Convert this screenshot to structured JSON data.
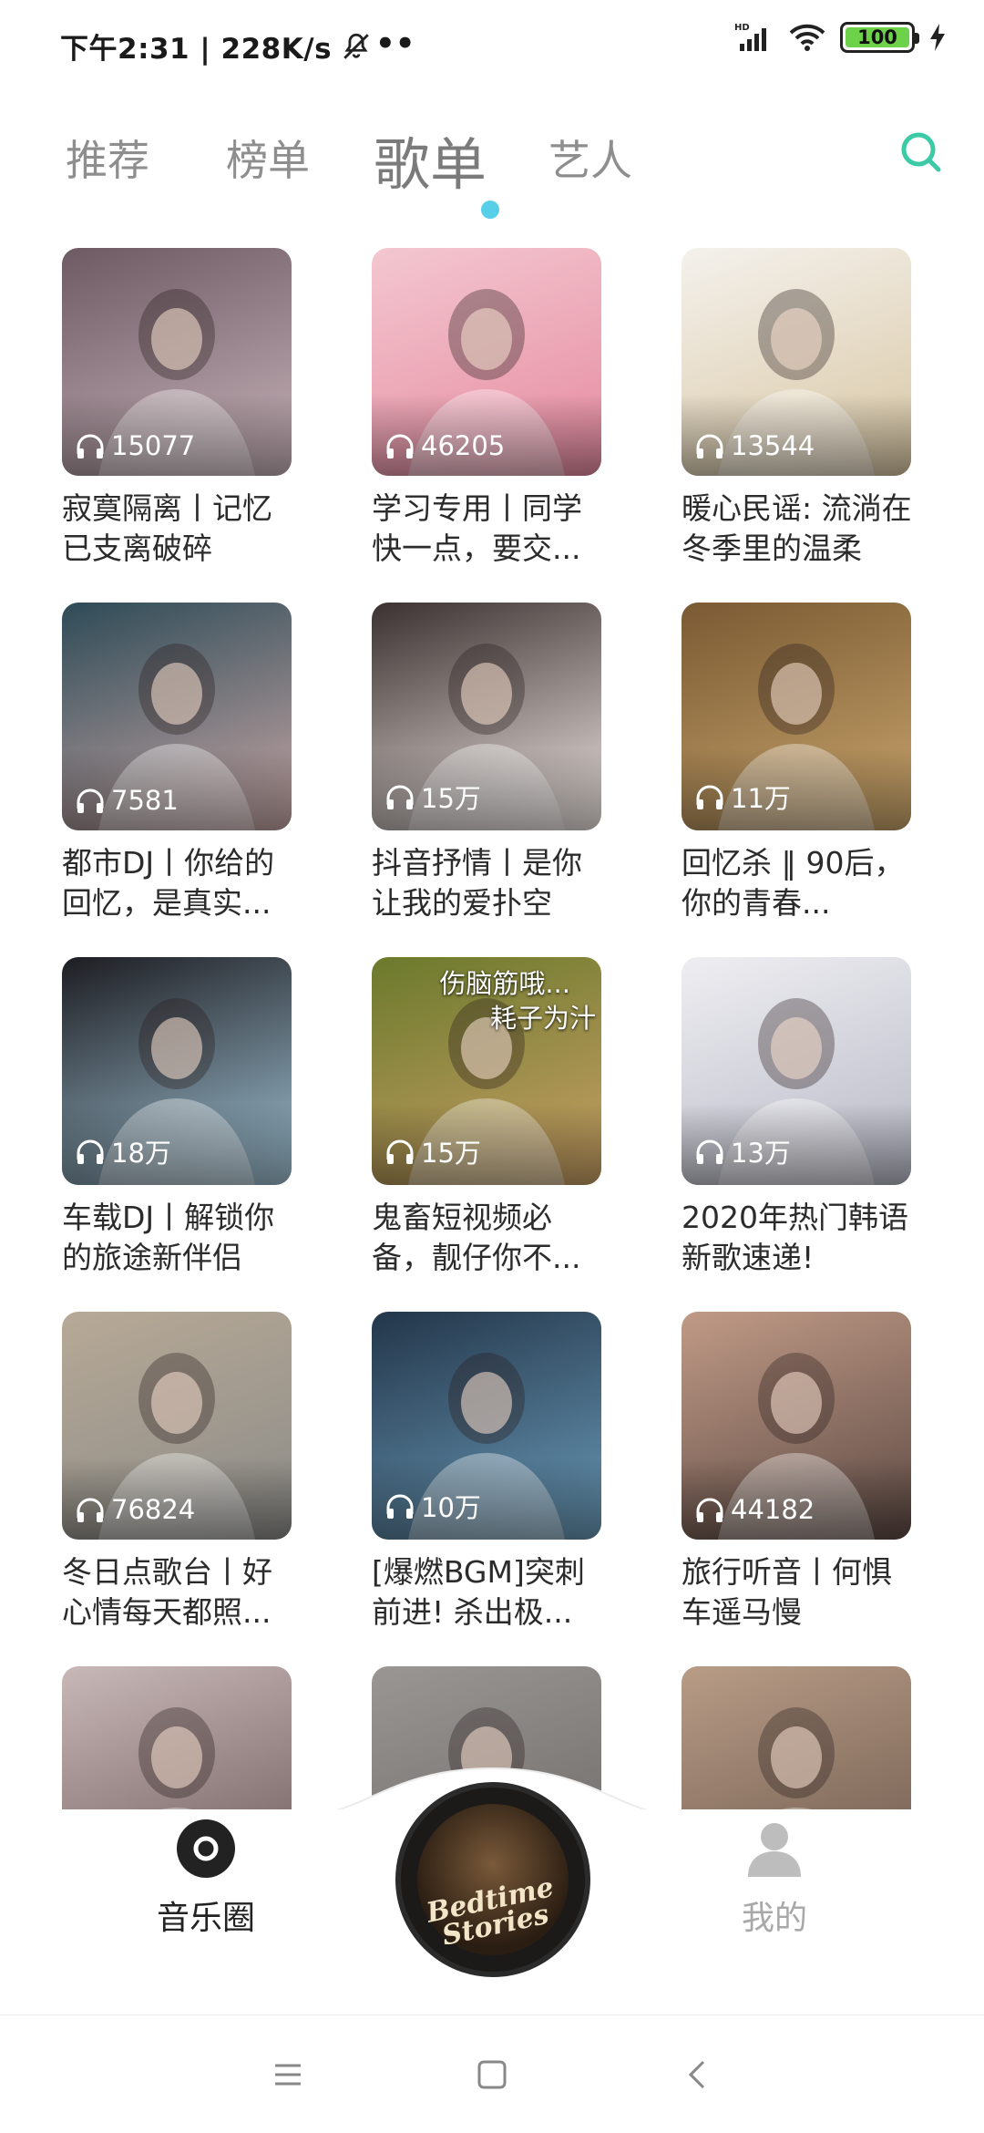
{
  "status_bar": {
    "time_speed": "下午2:31 | 228K/s",
    "dots": "••",
    "battery_level": "100",
    "signal_label": "HD"
  },
  "tabs": [
    {
      "label": "推荐",
      "active": false
    },
    {
      "label": "榜单",
      "active": false
    },
    {
      "label": "歌单",
      "active": true
    },
    {
      "label": "艺人",
      "active": false
    }
  ],
  "accent_color": "#58cfe8",
  "playlists": [
    {
      "count": "15077",
      "title": "寂寞隔离丨记忆已支离破碎",
      "colors": [
        "#6d5a63",
        "#c7b2b9"
      ]
    },
    {
      "count": "46205",
      "title": "学习专用丨同学快一点，要交...",
      "colors": [
        "#f3c7d0",
        "#e68aa0"
      ]
    },
    {
      "count": "13544",
      "title": "暖心民谣: 流淌在冬季里的温柔",
      "colors": [
        "#f4f1ec",
        "#d8c6a3"
      ]
    },
    {
      "count": "7581",
      "title": "都市DJ丨你给的回忆，是真实...",
      "colors": [
        "#2e4b57",
        "#c7a7a6"
      ]
    },
    {
      "count": "15万",
      "title": "抖音抒情丨是你让我的爱扑空",
      "colors": [
        "#3a3130",
        "#efe6e2"
      ]
    },
    {
      "count": "11万",
      "title": "回忆杀 ‖ 90后，你的青春...",
      "colors": [
        "#7a5a33",
        "#c9a56c"
      ]
    },
    {
      "count": "18万",
      "title": "车载DJ丨解锁你的旅途新伴侣",
      "colors": [
        "#1d1d22",
        "#9fc1d3"
      ]
    },
    {
      "count": "15万",
      "title": "鬼畜短视频必备，靓仔你不...",
      "colors": [
        "#6b7a2c",
        "#caa066"
      ],
      "overlay": [
        "伤脑筋哦...",
        "耗子为汁"
      ]
    },
    {
      "count": "13万",
      "title": "2020年热门韩语新歌速递!",
      "colors": [
        "#eeeef2",
        "#b8b8c6"
      ]
    },
    {
      "count": "76824",
      "title": "冬日点歌台丨好心情每天都照...",
      "colors": [
        "#b7a996",
        "#8b8b88"
      ]
    },
    {
      "count": "10万",
      "title": "[爆燃BGM]突刺前进! 杀出极...",
      "colors": [
        "#23364a",
        "#6a9ab8"
      ]
    },
    {
      "count": "44182",
      "title": "旅行听音丨何惧车遥马慢",
      "colors": [
        "#c09a86",
        "#5d4a44"
      ]
    },
    {
      "count": "",
      "title": "",
      "colors": [
        "#c9b8b8",
        "#6e5a5a"
      ]
    },
    {
      "count": "",
      "title": "",
      "colors": [
        "#9a9694",
        "#6c6866"
      ]
    },
    {
      "count": "",
      "title": "",
      "colors": [
        "#b89c86",
        "#6e5a4e"
      ]
    }
  ],
  "bottom_nav": {
    "left_label": "音乐圈",
    "right_label": "我的",
    "disc_text": "Bedtime Stories"
  }
}
